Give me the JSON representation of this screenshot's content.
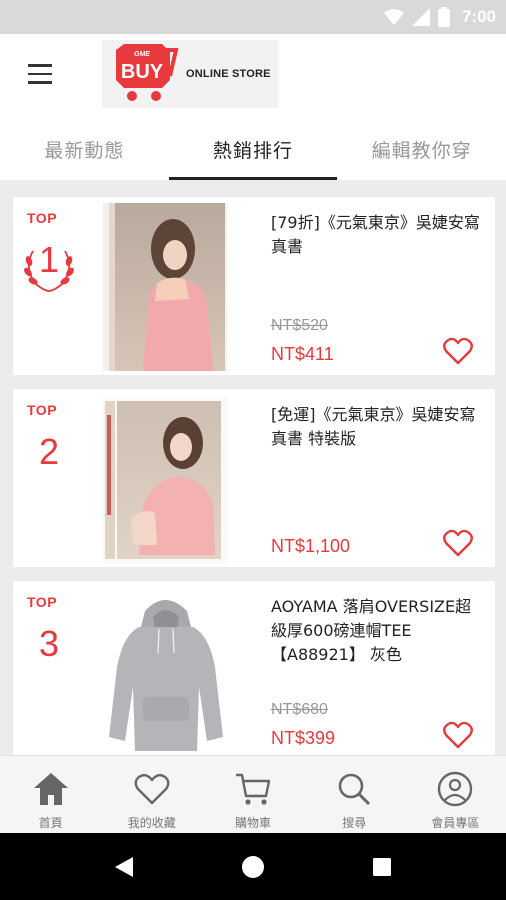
{
  "status_bar": {
    "time": "7:00",
    "icons": [
      "wifi-icon",
      "signal-icon",
      "battery-icon"
    ]
  },
  "header": {
    "menu_icon": "hamburger-menu-icon",
    "logo": {
      "brand_small": "GME",
      "brand_main": "BUY",
      "tagline": "ONLINE STORE"
    }
  },
  "tabs": [
    {
      "label": "最新動態",
      "active": false
    },
    {
      "label": "熱銷排行",
      "active": true
    },
    {
      "label": "編輯教你穿",
      "active": false
    }
  ],
  "products": [
    {
      "rank_label": "TOP",
      "rank": "1",
      "title": "[79折]《元氣東京》吳婕安寫真書",
      "original_price": "NT$520",
      "price": "NT$411",
      "thumb_type": "book"
    },
    {
      "rank_label": "TOP",
      "rank": "2",
      "title": "[免運]《元氣東京》吳婕安寫真書 特裝版",
      "original_price": "",
      "price": "NT$1,100",
      "thumb_type": "book-special"
    },
    {
      "rank_label": "TOP",
      "rank": "3",
      "title": "AOYAMA 落肩OVERSIZE超級厚600磅連帽TEE【A88921】 灰色",
      "original_price": "NT$680",
      "price": "NT$399",
      "thumb_type": "hoodie"
    }
  ],
  "bottom_nav": [
    {
      "label": "首頁",
      "icon": "home-icon",
      "active": true
    },
    {
      "label": "我的收藏",
      "icon": "heart-icon",
      "active": false
    },
    {
      "label": "購物車",
      "icon": "cart-icon",
      "active": false
    },
    {
      "label": "搜尋",
      "icon": "search-icon",
      "active": false
    },
    {
      "label": "會員專區",
      "icon": "user-icon",
      "active": false
    }
  ],
  "colors": {
    "accent": "#e8393e",
    "text": "#222222",
    "muted": "#999999",
    "nav_icon": "#666666"
  }
}
